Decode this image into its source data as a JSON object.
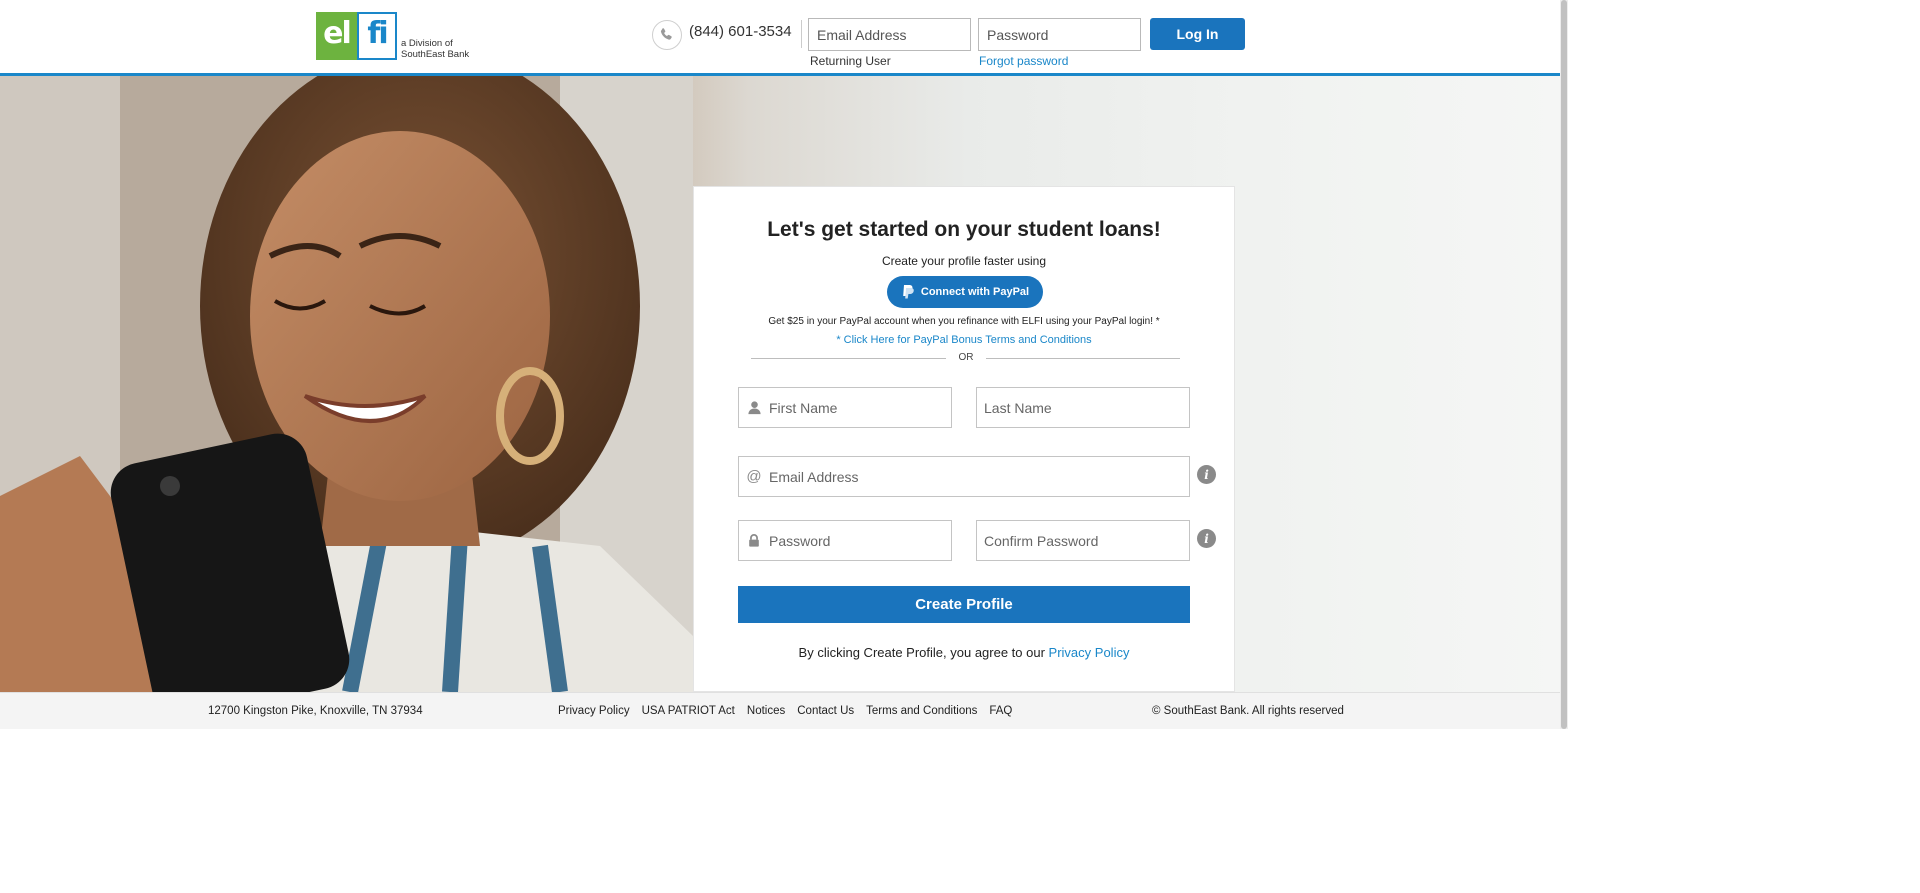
{
  "header": {
    "logo_el": "el",
    "logo_fi": "fi",
    "logo_sub_1": "a Division of",
    "logo_sub_2": "SouthEast Bank",
    "phone": "(844) 601-3534",
    "email_placeholder": "Email Address",
    "password_placeholder": "Password",
    "login_label": "Log In",
    "returning_user": "Returning User",
    "forgot_password": "Forgot password"
  },
  "card": {
    "title": "Let's get started on your student loans!",
    "subtitle": "Create your profile faster using",
    "paypal_label": "Connect with PayPal",
    "bonus_text": "Get $25 in your PayPal account when you refinance with ELFI using your PayPal login! *",
    "bonus_link": "* Click Here for PayPal Bonus Terms and Conditions",
    "or": "OR",
    "fields": {
      "first_name": "First Name",
      "last_name": "Last Name",
      "email": "Email Address",
      "password": "Password",
      "confirm_password": "Confirm Password"
    },
    "create_label": "Create Profile",
    "agree_text": "By clicking Create Profile, you agree to our ",
    "privacy_link": "Privacy Policy"
  },
  "footer": {
    "address": "12700 Kingston Pike, Knoxville, TN 37934",
    "links": [
      "Privacy Policy",
      "USA PATRIOT Act",
      "Notices",
      "Contact Us",
      "Terms and Conditions",
      "FAQ"
    ],
    "copyright": "© SouthEast Bank. All rights reserved"
  },
  "colors": {
    "brand_blue": "#1a74bd",
    "link_blue": "#1a87c9",
    "logo_green": "#6db33f"
  },
  "icons": {
    "phone": "phone-icon",
    "paypal": "paypal-icon",
    "user": "user-icon",
    "at": "at-icon",
    "lock": "lock-icon",
    "info": "info-icon"
  }
}
